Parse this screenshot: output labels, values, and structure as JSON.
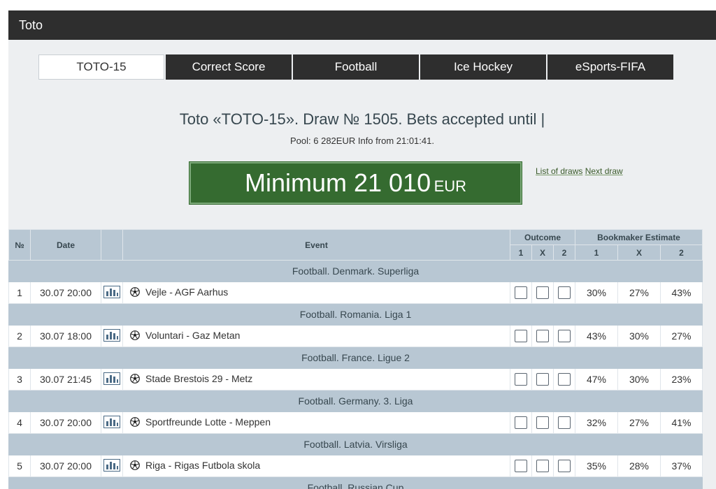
{
  "window": {
    "title": "Toto"
  },
  "tabs": [
    {
      "label": "TOTO-15",
      "active": true
    },
    {
      "label": "Correct Score",
      "active": false
    },
    {
      "label": "Football",
      "active": false
    },
    {
      "label": "Ice Hockey",
      "active": false
    },
    {
      "label": "eSports-FIFA",
      "active": false
    }
  ],
  "draw": {
    "title": "Toto «TOTO-15». Draw № 1505. Bets accepted until |",
    "pool_line": "Pool: 6 282EUR Info from 21:01:41.",
    "prize_prefix": "Minimum 21 010",
    "prize_currency": "EUR",
    "list_of_draws_link": "List of draws",
    "next_draw_link": "Next draw"
  },
  "table": {
    "headers": {
      "no": "№",
      "date": "Date",
      "event": "Event",
      "outcome": "Outcome",
      "bookmaker": "Bookmaker Estimate",
      "out_1": "1",
      "out_x": "X",
      "out_2": "2",
      "bm_1": "1",
      "bm_x": "X",
      "bm_2": "2"
    },
    "groups": [
      {
        "league": "Football. Denmark. Superliga",
        "match": {
          "no": "1",
          "date": "30.07 20:00",
          "event": "Vejle - AGF Aarhus",
          "p1": "30%",
          "px": "27%",
          "p2": "43%"
        }
      },
      {
        "league": "Football. Romania. Liga 1",
        "match": {
          "no": "2",
          "date": "30.07 18:00",
          "event": "Voluntari - Gaz Metan",
          "p1": "43%",
          "px": "30%",
          "p2": "27%"
        }
      },
      {
        "league": "Football. France. Ligue 2",
        "match": {
          "no": "3",
          "date": "30.07 21:45",
          "event": "Stade Brestois 29 - Metz",
          "p1": "47%",
          "px": "30%",
          "p2": "23%"
        }
      },
      {
        "league": "Football. Germany. 3. Liga",
        "match": {
          "no": "4",
          "date": "30.07 20:00",
          "event": "Sportfreunde Lotte - Meppen",
          "p1": "32%",
          "px": "27%",
          "p2": "41%"
        }
      },
      {
        "league": "Football. Latvia. Virsliga",
        "match": {
          "no": "5",
          "date": "30.07 20:00",
          "event": "Riga - Rigas Futbola skola",
          "p1": "35%",
          "px": "28%",
          "p2": "37%"
        }
      },
      {
        "league": "Football. Russian Cup"
      }
    ]
  },
  "colors": {
    "titlebar": "#2e2e2e",
    "panel": "#edeff1",
    "header_row": "#b8c7d3",
    "prize_green": "#356b30"
  },
  "icons": {
    "stats": "bar-chart-icon",
    "sport": "soccer-ball-icon"
  }
}
